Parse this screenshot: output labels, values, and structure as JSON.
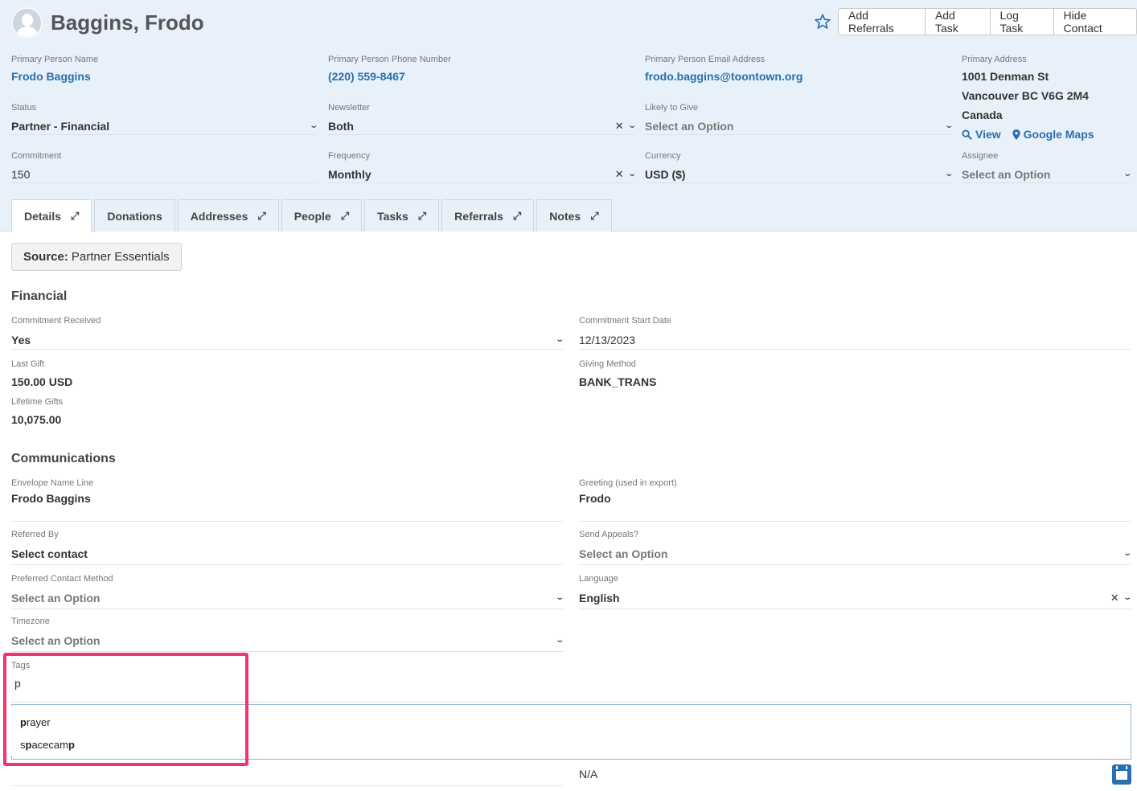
{
  "contact": {
    "name": "Baggins, Frodo"
  },
  "actions": {
    "add_referrals": "Add Referrals",
    "add_task": "Add Task",
    "log_task": "Log Task",
    "hide_contact": "Hide Contact"
  },
  "header_fields": {
    "primary_name": {
      "label": "Primary Person Name",
      "value": "Frodo Baggins"
    },
    "phone": {
      "label": "Primary Person Phone Number",
      "value": "(220) 559-8467"
    },
    "email": {
      "label": "Primary Person Email Address",
      "value": "frodo.baggins@toontown.org"
    },
    "address": {
      "label": "Primary Address",
      "line1": "1001 Denman St",
      "line2": "Vancouver BC V6G 2M4",
      "line3": "Canada",
      "view_link": "View",
      "maps_link": "Google Maps"
    },
    "status": {
      "label": "Status",
      "value": "Partner - Financial"
    },
    "newsletter": {
      "label": "Newsletter",
      "value": "Both"
    },
    "likely_to_give": {
      "label": "Likely to Give",
      "value": "Select an Option"
    },
    "commitment": {
      "label": "Commitment",
      "value": "150"
    },
    "frequency": {
      "label": "Frequency",
      "value": "Monthly"
    },
    "currency": {
      "label": "Currency",
      "value": "USD ($)"
    },
    "assignee": {
      "label": "Assignee",
      "value": "Select an Option"
    }
  },
  "tabs": [
    {
      "label": "Details"
    },
    {
      "label": "Donations"
    },
    {
      "label": "Addresses"
    },
    {
      "label": "People"
    },
    {
      "label": "Tasks"
    },
    {
      "label": "Referrals"
    },
    {
      "label": "Notes"
    }
  ],
  "source": {
    "prefix": "Source:",
    "value": "Partner Essentials"
  },
  "financial": {
    "title": "Financial",
    "commitment_received": {
      "label": "Commitment Received",
      "value": "Yes"
    },
    "commitment_start": {
      "label": "Commitment Start Date",
      "value": "12/13/2023"
    },
    "last_gift": {
      "label": "Last Gift",
      "value": "150.00 USD"
    },
    "giving_method": {
      "label": "Giving Method",
      "value": "BANK_TRANS"
    },
    "lifetime_gifts": {
      "label": "Lifetime Gifts",
      "value": "10,075.00"
    }
  },
  "communications": {
    "title": "Communications",
    "envelope": {
      "label": "Envelope Name Line",
      "value": "Frodo Baggins"
    },
    "greeting": {
      "label": "Greeting (used in export)",
      "value": "Frodo"
    },
    "referred_by": {
      "label": "Referred By",
      "value": "Select contact"
    },
    "send_appeals": {
      "label": "Send Appeals?",
      "value": "Select an Option"
    },
    "preferred_method": {
      "label": "Preferred Contact Method",
      "value": "Select an Option"
    },
    "language": {
      "label": "Language",
      "value": "English"
    },
    "timezone": {
      "label": "Timezone",
      "value": "Select an Option"
    },
    "tags": {
      "label": "Tags",
      "input_value": "p"
    },
    "next_field": {
      "value": "N/A"
    }
  },
  "tag_suggestions": [
    {
      "before": "",
      "match": "p",
      "after": "rayer"
    },
    {
      "before": "s",
      "match": "p",
      "after": "acecam",
      "match2": "p"
    }
  ],
  "colors": {
    "accent": "#2a6fad",
    "header_bg": "#e8f1f9",
    "highlight": "#f0346e"
  }
}
